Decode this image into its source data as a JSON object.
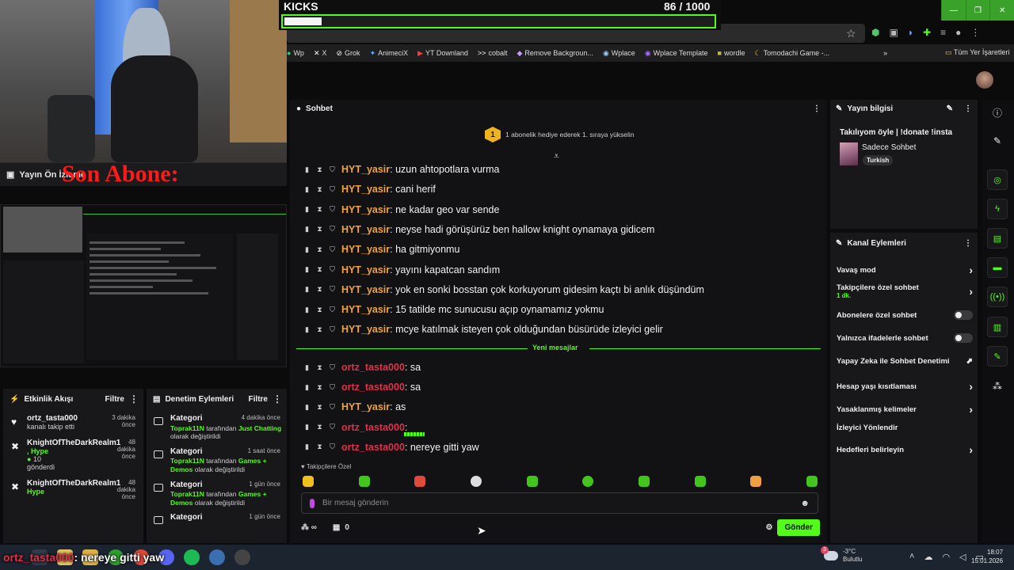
{
  "browser": {
    "kicks_label": "KICKS",
    "kicks_count": "86 / 1000",
    "kicks_progress": 0.086,
    "bookmarks": [
      {
        "label": "Wp",
        "icon": "whatsapp-icon"
      },
      {
        "label": "X",
        "icon": "x-icon"
      },
      {
        "label": "Grok",
        "icon": "grok-icon"
      },
      {
        "label": "AnimeciX",
        "icon": "animecix-icon"
      },
      {
        "label": "YT Downland",
        "icon": "youtube-icon"
      },
      {
        "label": "cobalt",
        "icon": "cobalt-icon"
      },
      {
        "label": "Remove Backgroun...",
        "icon": "removebg-icon"
      },
      {
        "label": "Wplace",
        "icon": "globe-icon"
      },
      {
        "label": "Wplace Template",
        "icon": "globe-icon"
      },
      {
        "label": "wordle",
        "icon": "wordle-icon"
      },
      {
        "label": "Tomodachi Game -...",
        "icon": "crescent-icon"
      }
    ],
    "all_bookmarks": "Tüm Yer İşaretleri"
  },
  "obs": {
    "preview_title": "Yayın Ön İzleme",
    "son_abone": "Son Abone:",
    "activity_title": "Etkinlik Akışı",
    "activity_filter": "Filtre",
    "activity": [
      {
        "user": "ortz_tasta000",
        "desc": "kanalı takip etti",
        "time": "3 dakika önce",
        "icon": "heart-icon"
      },
      {
        "user": "KnightOfTheDarkRealm1",
        "hype": ", Hype",
        "amount": "10",
        "desc": "gönderdi",
        "time": "48 dakika önce",
        "icon": "kick-icon"
      },
      {
        "user": "KnightOfTheDarkRealm1",
        "hype": "Hype",
        "time": "48 dakika önce",
        "icon": "kick-icon"
      }
    ],
    "mod_title": "Denetim Eylemleri",
    "mod_filter": "Filtre",
    "mod": [
      {
        "title": "Kategori",
        "time": "4 dakika önce",
        "who": "Toprak11N",
        "mid": " tarafından ",
        "cat": "Just Chatting",
        "end": " olarak değiştirildi"
      },
      {
        "title": "Kategori",
        "time": "1 saat önce",
        "who": "Toprak11N",
        "mid": " tarafından ",
        "cat": "Games + Demos",
        "end": " olarak değiştirildi"
      },
      {
        "title": "Kategori",
        "time": "1 gün önce",
        "who": "Toprak11N",
        "mid": " tarafından ",
        "cat": "Games + Demos",
        "end": " olarak değiştirildi"
      },
      {
        "title": "Kategori",
        "time": "1 gün önce"
      }
    ]
  },
  "chat": {
    "title": "Sohbet",
    "gift_rank": "1",
    "gift_text": "1 abonelik hediye ederek 1. sıraya yükselin",
    "messages": [
      {
        "user": "HYT_yasir",
        "text": "uzun ahtopotlara vurma",
        "color": "hyt"
      },
      {
        "user": "HYT_yasir",
        "text": "cani herif",
        "color": "hyt"
      },
      {
        "user": "HYT_yasir",
        "text": "ne kadar geo var sende",
        "color": "hyt"
      },
      {
        "user": "HYT_yasir",
        "text": "neyse hadi görüşürüz ben hallow knight oynamaya gidicem",
        "color": "hyt"
      },
      {
        "user": "HYT_yasir",
        "text": "ha gitmiyonmu",
        "color": "hyt"
      },
      {
        "user": "HYT_yasir",
        "text": "yayını kapatcan sandım",
        "color": "hyt"
      },
      {
        "user": "HYT_yasir",
        "text": "yok en sonki bosstan çok korkuyorum gidesim kaçtı bi anlık düşündüm",
        "color": "hyt"
      },
      {
        "user": "HYT_yasir",
        "text": "15 tatilde mc sunucusu açıp oynamamız yokmu",
        "color": "hyt"
      },
      {
        "user": "HYT_yasir",
        "text": "mcye katılmak isteyen çok olduğundan büsürüde izleyici gelir",
        "color": "hyt"
      }
    ],
    "new_messages_label": "Yeni mesajlar",
    "new_messages": [
      {
        "user": "ortz_tasta000",
        "text": "sa",
        "color": "ortz"
      },
      {
        "user": "ortz_tasta000",
        "text": "sa",
        "color": "ortz"
      },
      {
        "user": "HYT_yasir",
        "text": "as",
        "color": "hyt"
      },
      {
        "user": "ortz_tasta000",
        "text": "",
        "color": "ortz",
        "emote": true
      },
      {
        "user": "ortz_tasta000",
        "text": "nereye gitti yaw",
        "color": "ortz"
      }
    ],
    "followers_only": "Takipçilere Özel",
    "input_placeholder": "Bir mesaj gönderin",
    "points": "0",
    "send_label": "Gönder"
  },
  "stream_info": {
    "title": "Yayın bilgisi",
    "stream_title": "Takılıyom öyle | !donate !insta",
    "category": "Sadece Sohbet",
    "language": "Turkish"
  },
  "channel_actions": {
    "title": "Kanal Eylemleri",
    "items": [
      {
        "label": "Vavaş mod"
      },
      {
        "label": "Takipçilere özel sohbet",
        "sub": "1 dk."
      },
      {
        "label": "Abonelere özel sohbet"
      },
      {
        "label": "Yalnızca ifadelerle sohbet"
      },
      {
        "label": "Yapay Zeka ile Sohbet Denetimi"
      },
      {
        "label": "Hesap yaşı kısıtlaması"
      },
      {
        "label": "Yasaklanmış kelimeler"
      },
      {
        "label": "İzleyici Yönlendir"
      },
      {
        "label": "Hedefleri belirleyin"
      }
    ]
  },
  "overlay": {
    "user": "ortz_tasta000",
    "text": ": nereye gitti yaw"
  },
  "taskbar": {
    "weather_temp": "-3°C",
    "weather_desc": "Bulutlu",
    "weather_badge": "3",
    "time": "18:07",
    "date": "15.01.2026"
  },
  "colors": {
    "accent": "#53fc18",
    "hyt": "#f2a33b",
    "ortz": "#e0304a"
  }
}
